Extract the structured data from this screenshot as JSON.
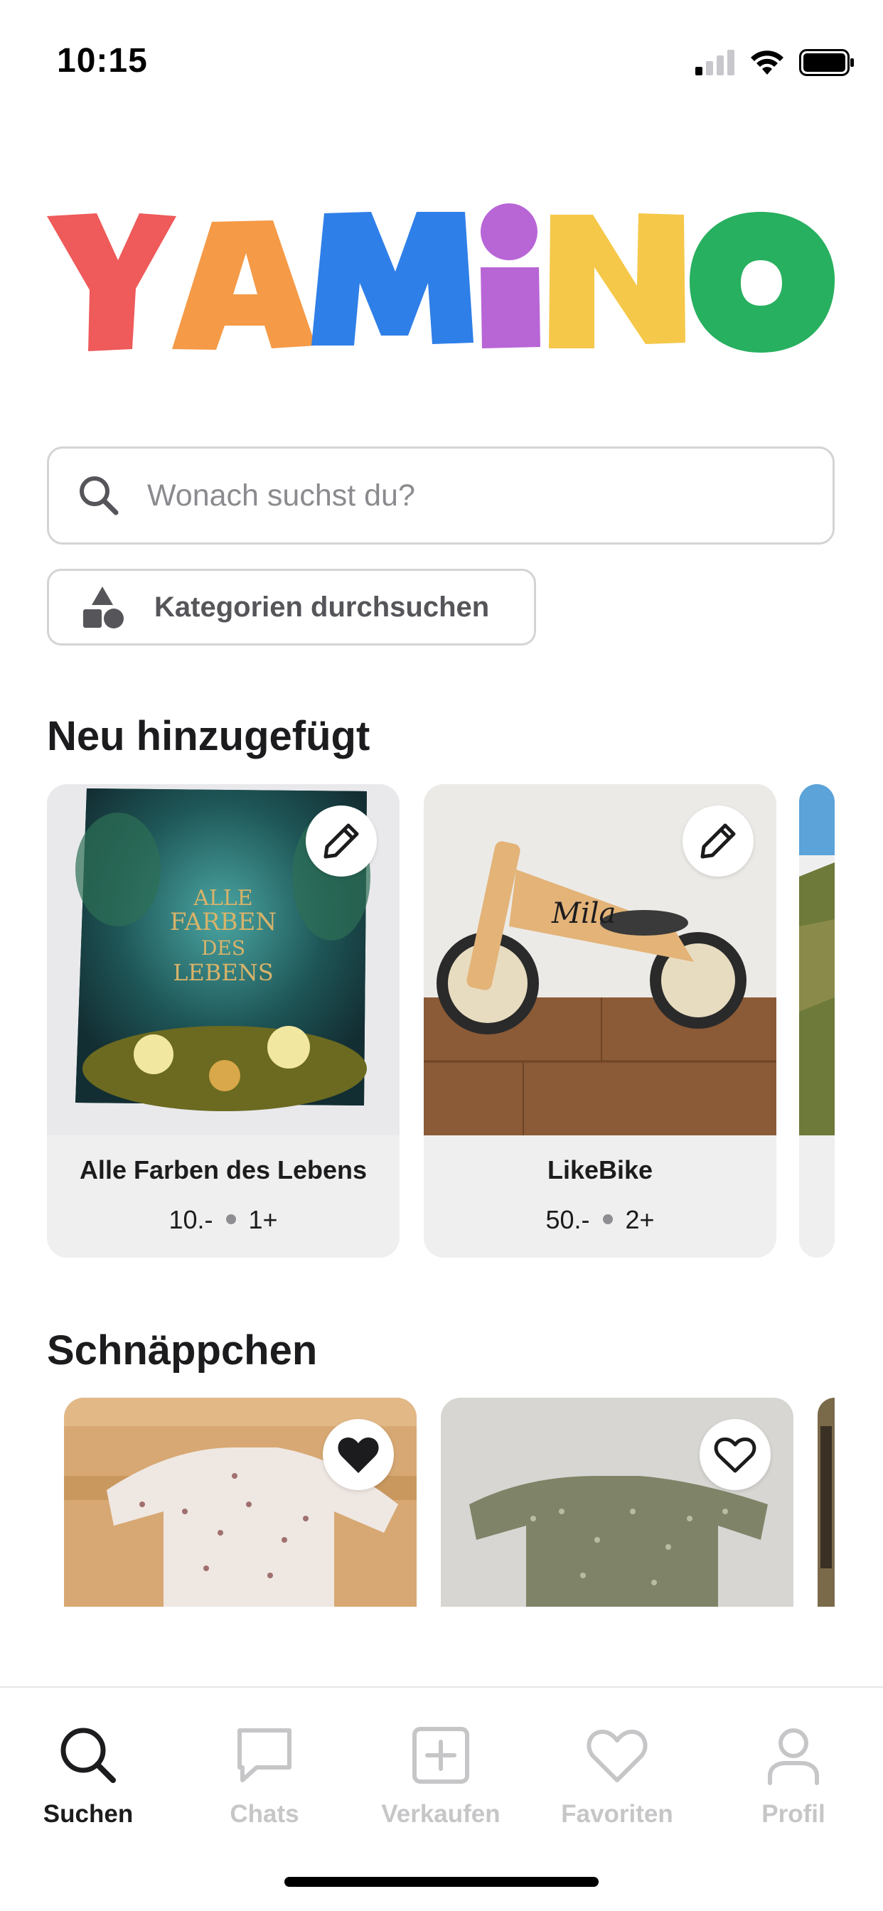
{
  "status_bar": {
    "time": "10:15"
  },
  "app": {
    "logo_text": "YAMiNO",
    "logo_colors": [
      "#ef5a5a",
      "#f59a47",
      "#2f7fe8",
      "#b865d6",
      "#f5c84a",
      "#27b05f"
    ]
  },
  "search": {
    "placeholder": "Wonach suchst du?",
    "value": ""
  },
  "categories_button": {
    "label": "Kategorien durchsuchen"
  },
  "sections": {
    "new": {
      "title": "Neu hinzugefügt",
      "items": [
        {
          "title": "Alle Farben des Lebens",
          "price": "10.-",
          "age": "1+",
          "action_icon": "pencil-icon"
        },
        {
          "title": "LikeBike",
          "price": "50.-",
          "age": "2+",
          "action_icon": "pencil-icon"
        }
      ]
    },
    "deals": {
      "title": "Schnäppchen",
      "items": [
        {
          "action_icon": "heart-filled-icon",
          "favorited": true
        },
        {
          "action_icon": "heart-outline-icon",
          "favorited": false
        }
      ]
    }
  },
  "tab_bar": {
    "tabs": [
      {
        "label": "Suchen",
        "icon": "search-icon",
        "active": true
      },
      {
        "label": "Chats",
        "icon": "chat-icon",
        "active": false
      },
      {
        "label": "Verkaufen",
        "icon": "plus-square-icon",
        "active": false
      },
      {
        "label": "Favoriten",
        "icon": "heart-outline-icon",
        "active": false
      },
      {
        "label": "Profil",
        "icon": "person-icon",
        "active": false
      }
    ]
  },
  "colors": {
    "accent": "#1c1c1e",
    "inactive": "#c6c6c8",
    "card_bg": "#efefef",
    "border": "#d4d4d6"
  }
}
